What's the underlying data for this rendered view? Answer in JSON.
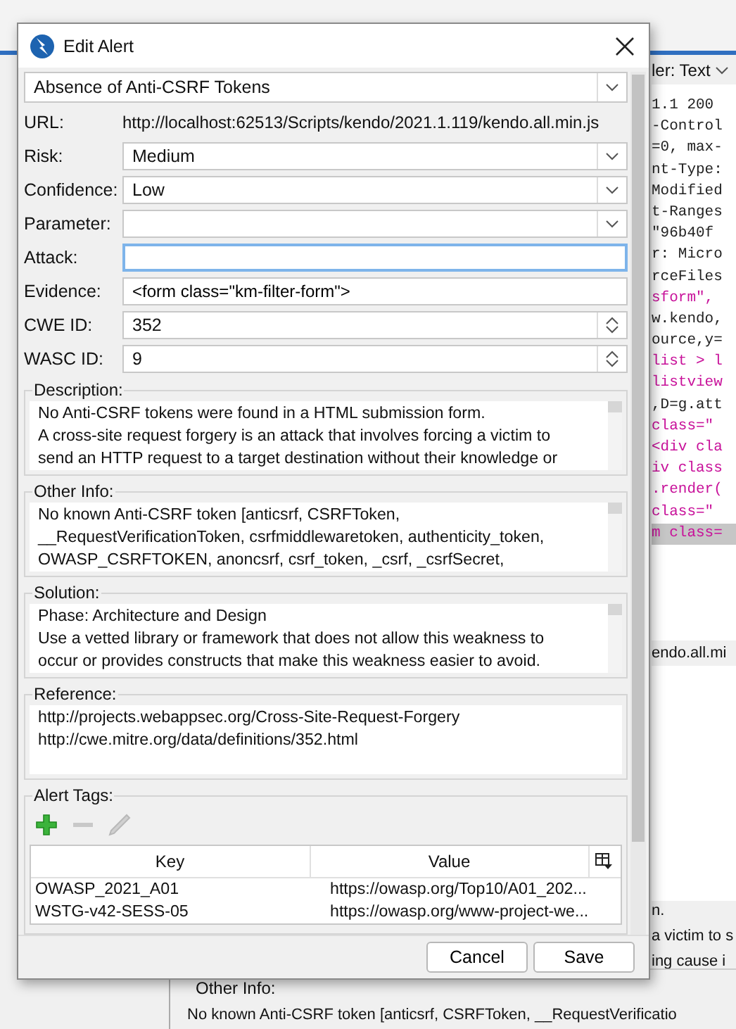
{
  "background": {
    "viewer_label": "ler: Text",
    "code_lines": [
      {
        "text": "1.1 200",
        "kind": "plain"
      },
      {
        "text": "-Control",
        "kind": "plain"
      },
      {
        "text": "=0, max-",
        "kind": "plain"
      },
      {
        "text": "nt-Type:",
        "kind": "plain"
      },
      {
        "text": "Modified",
        "kind": "plain"
      },
      {
        "text": "t-Ranges",
        "kind": "plain"
      },
      {
        "text": "\"96b40f",
        "kind": "plain"
      },
      {
        "text": "r: Micro",
        "kind": "plain"
      },
      {
        "text": "rceFiles",
        "kind": "plain"
      },
      {
        "text": "sform\",",
        "kind": "markup"
      },
      {
        "text": "w.kendo,",
        "kind": "plain"
      },
      {
        "text": "ource,y=",
        "kind": "plain"
      },
      {
        "text": "list > l",
        "kind": "markup"
      },
      {
        "text": "listview",
        "kind": "markup"
      },
      {
        "text": ",D=g.att",
        "kind": "plain"
      },
      {
        "text": "class=\"",
        "kind": "markup"
      },
      {
        "text": "<div cla",
        "kind": "markup"
      },
      {
        "text": "iv class",
        "kind": "markup"
      },
      {
        "text": ".render(",
        "kind": "markup"
      },
      {
        "text": "class=\"",
        "kind": "markup"
      },
      {
        "text": "m class=",
        "kind": "selected"
      }
    ],
    "url_fragment": "endo.all.mi",
    "description_fragments": [
      "n.",
      "a victim to s",
      "ing cause i"
    ],
    "other_info": {
      "label": "Other Info:",
      "text": "No known Anti-CSRF token [anticsrf, CSRFToken, __RequestVerificatio"
    }
  },
  "dialog": {
    "title": "Edit Alert",
    "alert_name": "Absence of Anti-CSRF Tokens",
    "fields": [
      {
        "label": "URL:",
        "value": "http://localhost:62513/Scripts/kendo/2021.1.119/kendo.all.min.js",
        "kind": "text"
      },
      {
        "label": "Risk:",
        "value": "Medium",
        "kind": "dropdown"
      },
      {
        "label": "Confidence:",
        "value": "Low",
        "kind": "dropdown"
      },
      {
        "label": "Parameter:",
        "kind": "dropdown"
      },
      {
        "label": "Attack:",
        "kind": "input",
        "focused": true
      },
      {
        "label": "Evidence:",
        "value": "<form class=\"km-filter-form\">",
        "kind": "input",
        "focused": false
      },
      {
        "label": "CWE ID:",
        "value": "352",
        "kind": "spinner"
      },
      {
        "label": "WASC ID:",
        "value": "9",
        "kind": "spinner"
      }
    ],
    "sections": [
      {
        "title": "Description:",
        "kind": "scrolled",
        "lines": [
          "No Anti-CSRF tokens were found in a HTML submission form.",
          "A cross-site request forgery is an attack that involves forcing a victim to",
          "send an HTTP request to a target destination without their knowledge or"
        ]
      },
      {
        "title": "Other Info:",
        "kind": "scrolled",
        "lines": [
          "No known Anti-CSRF token [anticsrf, CSRFToken,",
          "__RequestVerificationToken, csrfmiddlewaretoken, authenticity_token,",
          "OWASP_CSRFTOKEN, anoncsrf, csrf_token, _csrf, _csrfSecret,"
        ]
      },
      {
        "title": "Solution:",
        "kind": "scrolled",
        "lines": [
          "Phase: Architecture and Design",
          "Use a vetted library or framework that does not allow this weakness to",
          "occur or provides constructs that make this weakness easier to avoid."
        ]
      },
      {
        "title": "Reference:",
        "kind": "plain",
        "lines": [
          "http://projects.webappsec.org/Cross-Site-Request-Forgery",
          "http://cwe.mitre.org/data/definitions/352.html"
        ]
      }
    ],
    "tags": {
      "title": "Alert Tags:",
      "columns": [
        "Key",
        "Value"
      ],
      "rows": [
        {
          "key": "OWASP_2021_A01",
          "value": "https://owasp.org/Top10/A01_202..."
        },
        {
          "key": "WSTG-v42-SESS-05",
          "value": "https://owasp.org/www-project-we..."
        }
      ]
    },
    "buttons": [
      "Cancel",
      "Save"
    ]
  }
}
